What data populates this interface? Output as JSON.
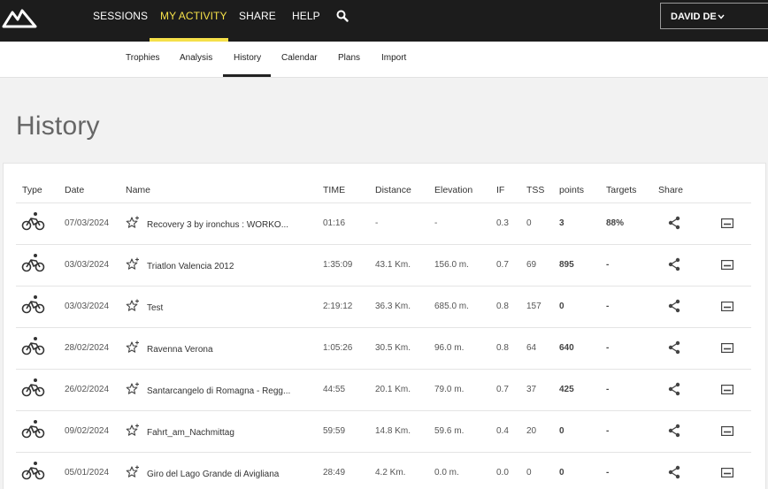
{
  "topnav": {
    "items": [
      "SESSIONS",
      "MY ACTIVITY",
      "SHARE",
      "HELP"
    ],
    "user_label": "DAVID DE"
  },
  "subnav": {
    "items": [
      "Trophies",
      "Analysis",
      "History",
      "Calendar",
      "Plans",
      "Import"
    ]
  },
  "page_title": "History",
  "table": {
    "headers": [
      "Type",
      "Date",
      "Name",
      "TIME",
      "Distance",
      "Elevation",
      "IF",
      "TSS",
      "points",
      "Targets",
      "Share"
    ],
    "rows": [
      {
        "date": "07/03/2024",
        "name": "Recovery 3 by ironchus : WORKO...",
        "time": "01:16",
        "distance": "-",
        "elevation": "-",
        "if": "0.3",
        "tss": "0",
        "points": "3",
        "targets": "88%"
      },
      {
        "date": "03/03/2024",
        "name": "Triatlon Valencia 2012",
        "time": "1:35:09",
        "distance": "43.1 Km.",
        "elevation": "156.0 m.",
        "if": "0.7",
        "tss": "69",
        "points": "895",
        "targets": "-"
      },
      {
        "date": "03/03/2024",
        "name": "Test",
        "time": "2:19:12",
        "distance": "36.3 Km.",
        "elevation": "685.0 m.",
        "if": "0.8",
        "tss": "157",
        "points": "0",
        "targets": "-"
      },
      {
        "date": "28/02/2024",
        "name": "Ravenna Verona",
        "time": "1:05:26",
        "distance": "30.5 Km.",
        "elevation": "96.0 m.",
        "if": "0.8",
        "tss": "64",
        "points": "640",
        "targets": "-"
      },
      {
        "date": "26/02/2024",
        "name": "Santarcangelo di Romagna - Regg...",
        "time": "44:55",
        "distance": "20.1 Km.",
        "elevation": "79.0 m.",
        "if": "0.7",
        "tss": "37",
        "points": "425",
        "targets": "-"
      },
      {
        "date": "09/02/2024",
        "name": "Fahrt_am_Nachmittag",
        "time": "59:59",
        "distance": "14.8 Km.",
        "elevation": "59.6 m.",
        "if": "0.4",
        "tss": "20",
        "points": "0",
        "targets": "-"
      },
      {
        "date": "05/01/2024",
        "name": "Giro del Lago Grande di Avigliana",
        "time": "28:49",
        "distance": "4.2 Km.",
        "elevation": "0.0 m.",
        "if": "0.0",
        "tss": "0",
        "points": "0",
        "targets": "-"
      }
    ]
  },
  "icons": {
    "logo": "mountain-logo-icon",
    "search": "search-icon",
    "type": "bike-icon",
    "favorite": "star-add-icon",
    "share": "share-icon",
    "more": "more-options-icon"
  },
  "colors": {
    "topbar": "#1c1c1c",
    "accent": "#f5e049",
    "background": "#f2f2f2"
  }
}
